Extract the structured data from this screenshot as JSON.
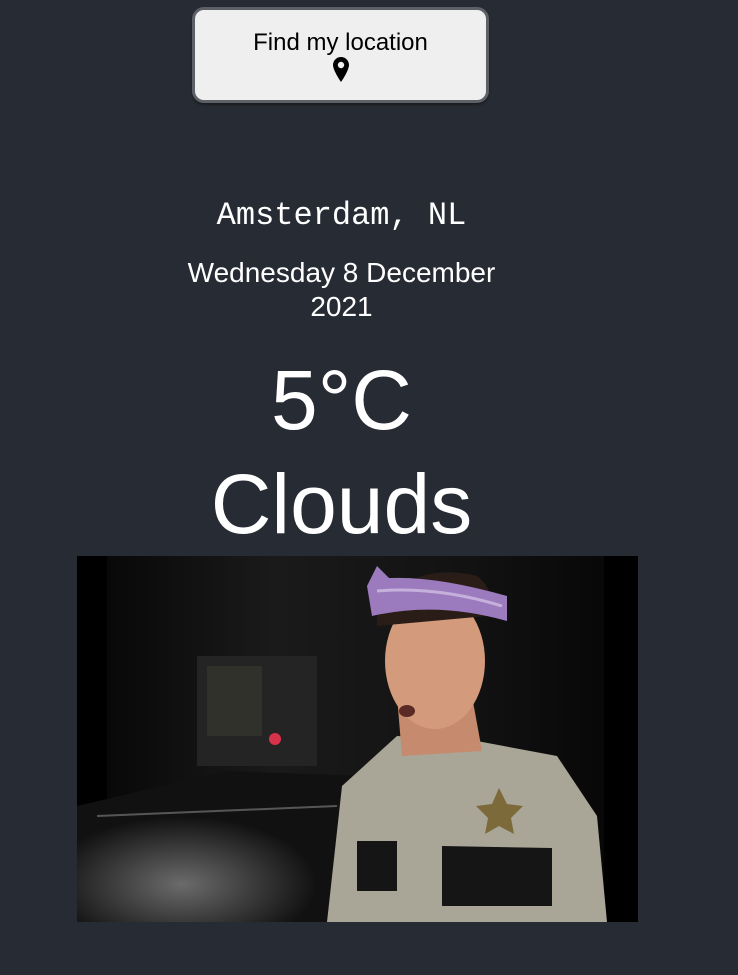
{
  "locate_button": {
    "label": "Find my location",
    "icon": "map-pin-icon"
  },
  "weather": {
    "location": "Amsterdam, NL",
    "date": "Wednesday 8 December 2021",
    "temperature": "5°C",
    "condition": "Clouds"
  },
  "media": {
    "subject": "reaction-gif"
  },
  "colors": {
    "background": "#272b33",
    "button_bg": "#efefef",
    "button_border": "#5d6067",
    "text": "#ffffff"
  }
}
